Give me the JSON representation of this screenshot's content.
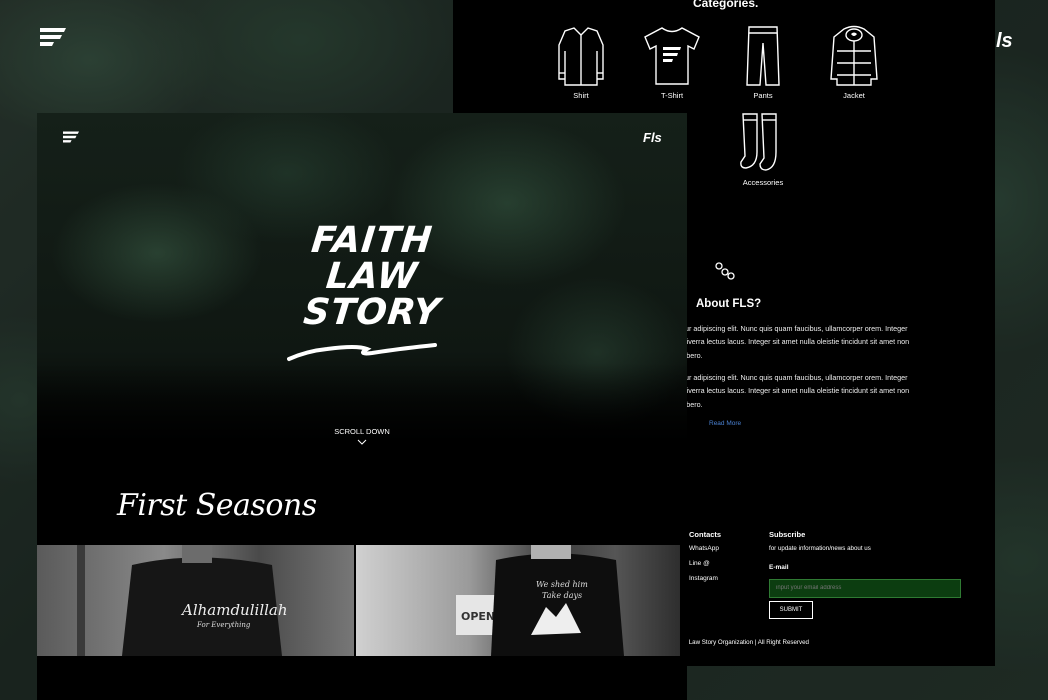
{
  "background": {
    "right_logo_text": "ls"
  },
  "categories": {
    "title": "Categories.",
    "items": [
      {
        "label": "Shirt",
        "icon": "shirt-icon"
      },
      {
        "label": "T-Shirt",
        "icon": "tshirt-icon"
      },
      {
        "label": "Pants",
        "icon": "pants-icon"
      },
      {
        "label": "Jacket",
        "icon": "jacket-icon"
      },
      {
        "label": "Accessories",
        "icon": "socks-icon"
      }
    ]
  },
  "about": {
    "title": "About FLS?",
    "paragraphs": [
      "tur adipiscing elit. Nunc quis quam faucibus, ullamcorper orem. Integer viverra lectus lacus. Integer sit amet nulla oleistie tincidunt sit amet non libero.",
      "tur adipiscing elit. Nunc quis quam faucibus, ullamcorper orem. Integer viverra lectus lacus. Integer sit amet nulla oleistie tincidunt sit amet non libero."
    ],
    "read_more": "Read More"
  },
  "footer": {
    "contacts": {
      "title": "Contacts",
      "items": [
        "WhatsApp",
        "Line @",
        "Instagram"
      ]
    },
    "subscribe": {
      "title": "Subscribe",
      "text": "for update information/news about us",
      "email_label": "E-mail",
      "email_placeholder": "input your email address",
      "submit_label": "SUBMIT"
    },
    "copyright": "aith Law Story Organization | All Right Reserved"
  },
  "hero": {
    "fls_text": "Fls",
    "brand_lines": [
      "FAITH",
      "LAW",
      "STORY"
    ],
    "scroll_down": "SCROLL DOWN"
  },
  "seasons": {
    "title": "First Seasons"
  },
  "colors": {
    "accent_link": "#4a80d0",
    "input_bg": "#0c3d10",
    "input_border": "#2f7a33"
  }
}
